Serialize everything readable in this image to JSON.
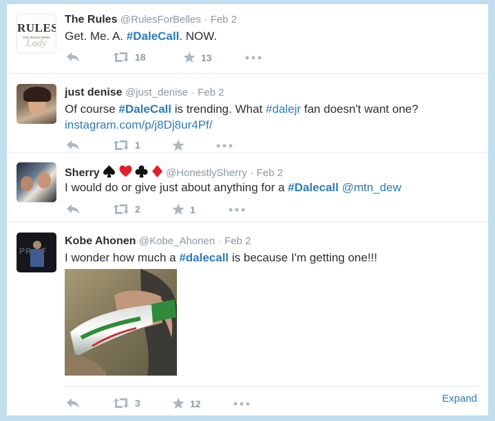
{
  "colors": {
    "link": "#2b7bb9",
    "muted": "#8899a6",
    "background": "#c0deed"
  },
  "tweets": [
    {
      "name": "The Rules",
      "handle": "@RulesForBelles",
      "date": "Feb 2",
      "text_pre": "Get. Me. A. ",
      "hashtag": "#DaleCall",
      "text_post": ". NOW.",
      "retweets": "18",
      "favorites": "13",
      "avatar_logo": {
        "line1": "RULES",
        "line2": "FOR THE SOUTHERN",
        "line3": "Lady"
      }
    },
    {
      "name": "just denise",
      "handle": "@just_denise",
      "date": "Feb 2",
      "text_pre": "Of course ",
      "hashtag": "#DaleCall",
      "text_mid": " is trending. What ",
      "hashtag2": "#dalejr",
      "text_post": " fan doesn't want one?",
      "link": "instagram.com/p/j8Dj8ur4Pf/",
      "retweets": "1",
      "favorites": ""
    },
    {
      "name": "Sherry",
      "handle": "@HonestlySherry",
      "date": "Feb 2",
      "text_pre": "I would do or give just about anything for a ",
      "hashtag": "#Dalecall",
      "mention": "@mtn_dew",
      "retweets": "2",
      "favorites": "1"
    },
    {
      "name": "Kobe Ahonen",
      "handle": "@Kobe_Ahonen",
      "date": "Feb 2",
      "text_pre": "I wonder how much a ",
      "hashtag": "#dalecall",
      "text_post": " is because I'm getting one!!!",
      "retweets": "3",
      "favorites": "12",
      "expand": "Expand",
      "avatar_text": "PR   F"
    }
  ],
  "separator": "·",
  "icons": [
    "reply-icon",
    "retweet-icon",
    "favorite-icon",
    "more-icon"
  ]
}
